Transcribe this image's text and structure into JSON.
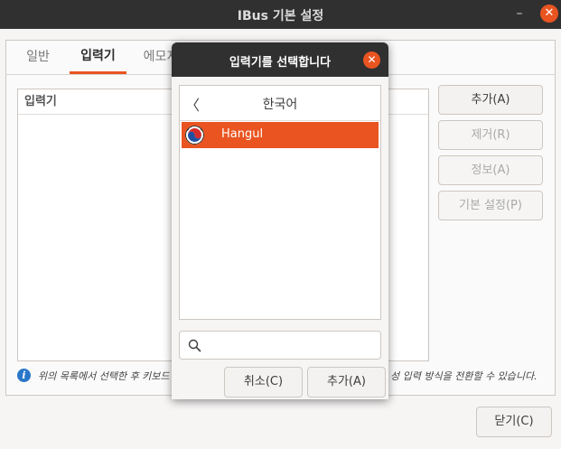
{
  "window": {
    "title": "IBus 기본 설정",
    "minimize_glyph": "–",
    "close_glyph": "✕"
  },
  "tabs": [
    {
      "label": "일반"
    },
    {
      "label": "입력기"
    },
    {
      "label": "에모지"
    }
  ],
  "engine_list": {
    "header": "입력기"
  },
  "side_buttons": {
    "add": "추가(A)",
    "remove": "제거(R)",
    "info": "정보(A)",
    "preferences": "기본 설정(P)"
  },
  "info": {
    "text_left": "위의 목록에서 선택한 후 키보드",
    "text_right": "성 입력 방식을 전환할 수 있습니다."
  },
  "close_button": "닫기(C)",
  "dialog": {
    "title": "입력기를 선택합니다",
    "close_glyph": "✕",
    "back_glyph": "〈",
    "language": "한국어",
    "items": [
      {
        "label": "Hangul",
        "selected": true,
        "icon": "taegeuk-icon"
      }
    ],
    "search": {
      "value": "",
      "placeholder": ""
    },
    "cancel_button": "취소(C)",
    "add_button": "추가(A)"
  },
  "colors": {
    "accent": "#e95420",
    "titlebar": "#303030",
    "info_blue": "#2a77c9"
  }
}
